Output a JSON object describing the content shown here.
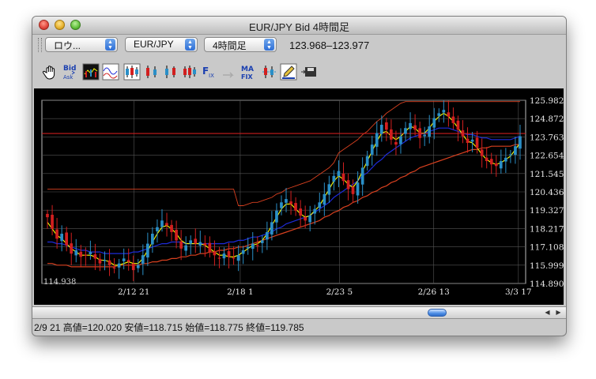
{
  "window": {
    "title": "EUR/JPY Bid 4時間足"
  },
  "toolbar": {
    "chart_type_select": "ロウ...",
    "pair_select": "EUR/JPY",
    "timeframe_select": "4時間足",
    "bid_range": "123.968–123.977"
  },
  "icons": [
    "hand-icon",
    "bid-ask-icon",
    "indicator-icon",
    "oscillator-icon",
    "candle-icon",
    "candle-icon",
    "candle-icon",
    "candle-icon",
    "fix-icon",
    "arrow-icon",
    "ma-fix-icon",
    "candle-settings-icon",
    "pencil-icon",
    "save-icon"
  ],
  "colors": {
    "background": "#000000",
    "grid": "#555555",
    "up_candle": "#2a8fc7",
    "down_candle": "#d21f1f",
    "ma_fast": "#ffff00",
    "ma_mid": "#1d2bd8",
    "ma_slow": "#d8401f",
    "price_line": "#c81e1e"
  },
  "chart_data": {
    "type": "candlestick",
    "y_ticks": [
      "125.982",
      "124.872",
      "123.763",
      "122.654",
      "121.545",
      "120.436",
      "119.327",
      "118.217",
      "117.108",
      "115.999",
      "114.890"
    ],
    "ylim": [
      114.89,
      125.982
    ],
    "x_ticks": [
      "2/12 21",
      "2/18 1",
      "2/23 5",
      "2/26 13",
      "3/3 17"
    ],
    "low_label": "114.938",
    "current_price": 123.972,
    "closes": [
      118.9,
      118.2,
      117.6,
      117.9,
      117.2,
      116.7,
      116.9,
      116.5,
      116.6,
      116.8,
      116.4,
      116.1,
      116.3,
      116.0,
      115.8,
      116.1,
      116.4,
      116.2,
      115.7,
      116.0,
      116.6,
      117.3,
      117.9,
      118.3,
      118.7,
      118.4,
      118.0,
      117.5,
      117.0,
      117.2,
      117.5,
      117.3,
      117.4,
      117.2,
      116.8,
      116.6,
      116.4,
      116.7,
      116.5,
      116.4,
      116.6,
      116.9,
      117.1,
      117.3,
      117.2,
      117.5,
      118.0,
      118.6,
      119.3,
      119.8,
      120.0,
      119.7,
      119.3,
      119.0,
      118.7,
      119.0,
      119.4,
      119.8,
      120.3,
      120.9,
      121.4,
      121.7,
      121.1,
      120.6,
      120.3,
      121.0,
      121.9,
      122.6,
      123.3,
      124.0,
      124.5,
      124.2,
      123.6,
      123.3,
      123.8,
      124.3,
      124.6,
      124.2,
      123.7,
      123.9,
      124.4,
      124.9,
      125.2,
      125.4,
      125.0,
      124.6,
      124.2,
      123.8,
      123.4,
      123.6,
      123.1,
      122.6,
      122.3,
      122.1,
      122.0,
      122.3,
      122.5,
      122.7,
      123.2,
      123.8
    ],
    "ma_fast": [
      118.6,
      118.2,
      117.8,
      117.6,
      117.3,
      117.0,
      116.8,
      116.6,
      116.6,
      116.6,
      116.5,
      116.3,
      116.3,
      116.2,
      116.0,
      116.0,
      116.1,
      116.2,
      116.1,
      116.1,
      116.4,
      116.9,
      117.4,
      117.9,
      118.3,
      118.4,
      118.2,
      117.9,
      117.5,
      117.3,
      117.3,
      117.3,
      117.3,
      117.2,
      117.0,
      116.8,
      116.6,
      116.6,
      116.5,
      116.5,
      116.6,
      116.8,
      117.0,
      117.2,
      117.3,
      117.5,
      117.9,
      118.4,
      118.9,
      119.4,
      119.7,
      119.7,
      119.4,
      119.1,
      118.9,
      119.0,
      119.3,
      119.6,
      120.1,
      120.6,
      121.1,
      121.4,
      121.2,
      120.9,
      120.7,
      121.1,
      121.7,
      122.3,
      122.9,
      123.5,
      124.0,
      124.1,
      123.8,
      123.6,
      123.8,
      124.1,
      124.4,
      124.3,
      124.0,
      124.0,
      124.3,
      124.7,
      125.0,
      125.2,
      125.0,
      124.7,
      124.3,
      123.9,
      123.5,
      123.4,
      123.1,
      122.7,
      122.4,
      122.2,
      122.1,
      122.2,
      122.4,
      122.6,
      123.0,
      123.4
    ],
    "ma_mid": [
      117.4,
      117.4,
      117.3,
      117.3,
      117.2,
      117.1,
      117.0,
      116.9,
      116.9,
      116.8,
      116.8,
      116.8,
      116.7,
      116.7,
      116.7,
      116.7,
      116.7,
      116.7,
      116.8,
      116.8,
      116.9,
      117.0,
      117.1,
      117.2,
      117.3,
      117.3,
      117.4,
      117.4,
      117.4,
      117.3,
      117.3,
      117.3,
      117.3,
      117.3,
      117.3,
      117.3,
      117.3,
      117.3,
      117.4,
      117.4,
      117.5,
      117.5,
      117.6,
      117.7,
      117.7,
      117.8,
      117.9,
      118.0,
      118.2,
      118.3,
      118.5,
      118.6,
      118.7,
      118.8,
      118.9,
      119.0,
      119.2,
      119.4,
      119.6,
      119.8,
      120.1,
      120.3,
      120.5,
      120.7,
      120.9,
      121.1,
      121.4,
      121.6,
      121.9,
      122.2,
      122.4,
      122.7,
      122.9,
      123.1,
      123.3,
      123.5,
      123.7,
      123.8,
      123.9,
      124.0,
      124.1,
      124.2,
      124.3,
      124.3,
      124.3,
      124.2,
      124.1,
      124.0,
      123.9,
      123.9,
      123.8,
      123.7,
      123.7,
      123.6,
      123.6,
      123.6,
      123.6,
      123.6,
      123.7,
      123.8
    ],
    "ma_slow": [
      116.1,
      116.1,
      116.0,
      116.0,
      116.0,
      115.9,
      115.9,
      115.9,
      115.9,
      115.9,
      115.9,
      115.9,
      115.9,
      115.9,
      115.9,
      116.0,
      116.0,
      116.0,
      116.0,
      116.0,
      116.1,
      116.1,
      116.2,
      116.2,
      116.3,
      116.3,
      116.4,
      116.4,
      116.5,
      116.5,
      116.6,
      116.6,
      116.7,
      116.7,
      116.8,
      116.8,
      116.9,
      116.9,
      117.0,
      117.0,
      117.1,
      117.1,
      117.2,
      117.3,
      117.4,
      117.5,
      117.6,
      117.7,
      117.8,
      117.9,
      118.0,
      118.1,
      118.2,
      118.3,
      118.4,
      118.5,
      118.6,
      118.7,
      118.9,
      119.0,
      119.2,
      119.3,
      119.5,
      119.6,
      119.8,
      119.9,
      120.1,
      120.2,
      120.4,
      120.5,
      120.7,
      120.8,
      121.0,
      121.1,
      121.3,
      121.4,
      121.6,
      121.7,
      121.9,
      122.0,
      122.1,
      122.2,
      122.3,
      122.4,
      122.5,
      122.6,
      122.7,
      122.8,
      122.9,
      123.0,
      123.0,
      123.1,
      123.1,
      123.2,
      123.2,
      123.2,
      123.2,
      123.2,
      123.3,
      123.3
    ]
  },
  "status": {
    "text": "2/9 21 高値=120.020 安値=118.715 始値=118.775 終値=119.785"
  }
}
